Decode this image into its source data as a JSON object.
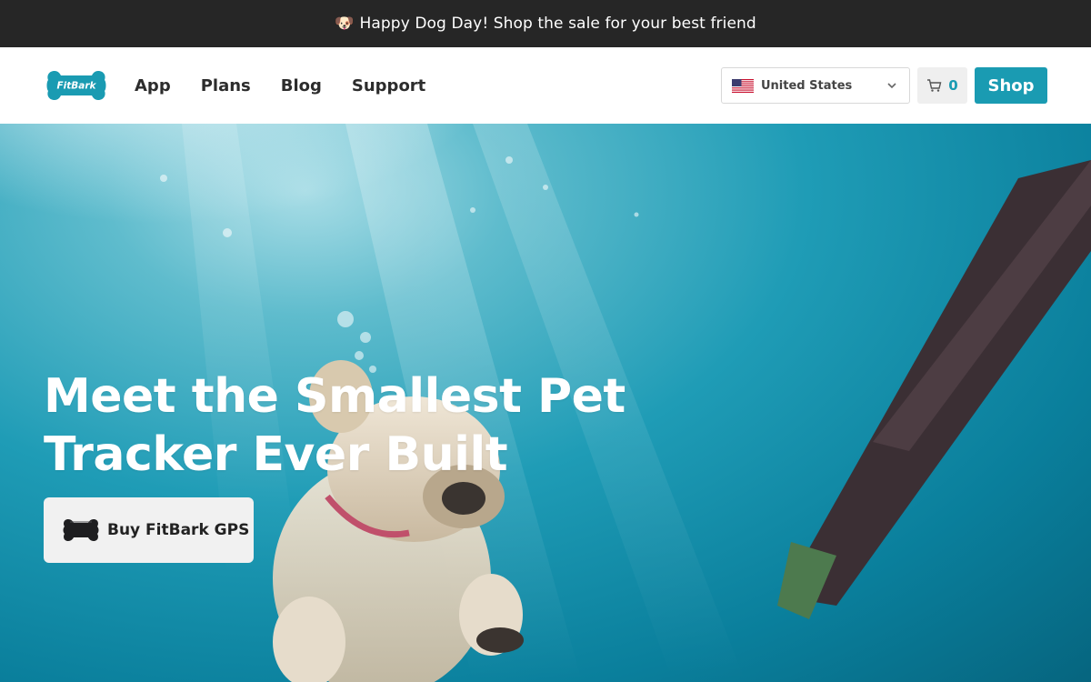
{
  "announcement": {
    "emoji": "🐶",
    "text": "Happy Dog Day! Shop the sale for your best friend"
  },
  "header": {
    "logo_text": "FitBark",
    "nav": [
      {
        "label": "App"
      },
      {
        "label": "Plans"
      },
      {
        "label": "Blog"
      },
      {
        "label": "Support"
      }
    ],
    "country": {
      "flag": "us-flag-icon",
      "value": "United States"
    },
    "cart": {
      "icon": "cart-icon",
      "count": "0"
    },
    "shop_label": "Shop"
  },
  "hero": {
    "headline_line1": "Meet the Smallest Pet",
    "headline_line2": "Tracker Ever Built",
    "cta_label": "Buy FitBark GPS",
    "cta_icon": "tracker-device-icon"
  },
  "colors": {
    "accent": "#1a9bb2",
    "announce_bg": "#262626",
    "cta_bg": "#f1f1f1"
  }
}
